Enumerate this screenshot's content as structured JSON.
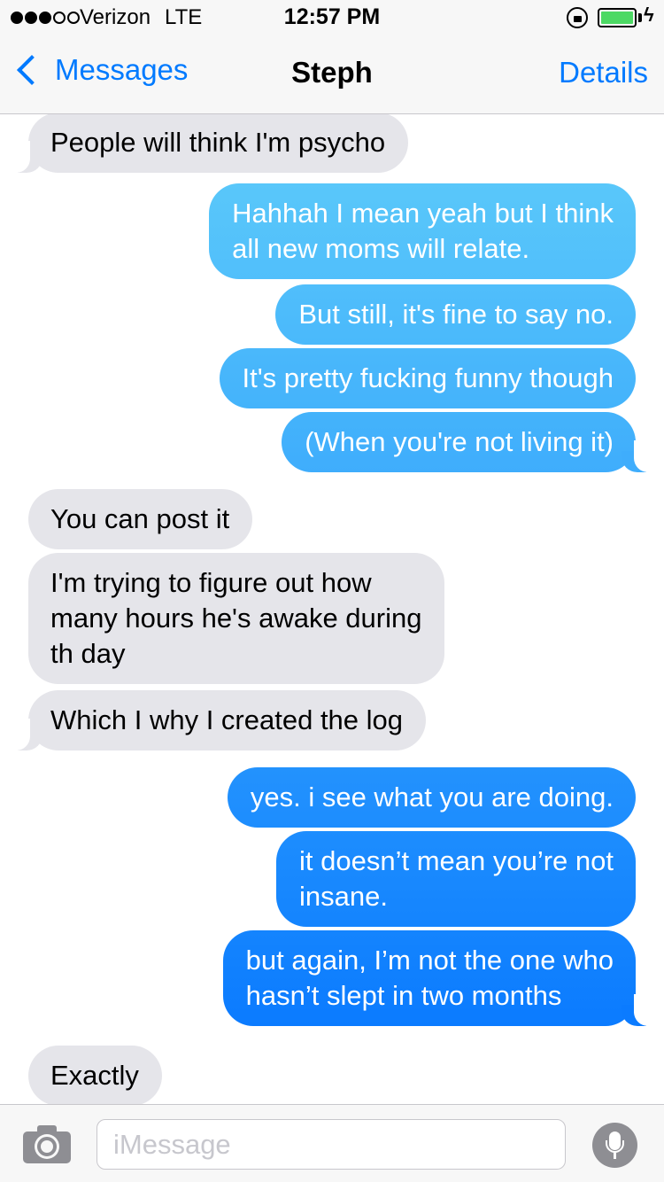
{
  "status_bar": {
    "carrier": "Verizon",
    "network": "LTE",
    "time": "12:57 PM",
    "signal_bars": 3,
    "signal_total": 5
  },
  "nav": {
    "back_label": "Messages",
    "title": "Steph",
    "details_label": "Details"
  },
  "colors": {
    "incoming_bubble": "#e5e5ea",
    "outgoing_gradient_top": "#5ac8fa",
    "outgoing_gradient_bottom": "#0a7aff",
    "link": "#007aff"
  },
  "messages": [
    {
      "dir": "in",
      "lines": [
        "People will think I'm psycho"
      ],
      "tail": true
    },
    {
      "dir": "out",
      "lines": [
        "Hahhah I mean yeah but I think",
        "all new moms will relate."
      ],
      "tail": false
    },
    {
      "dir": "out",
      "lines": [
        "But still, it's fine to say no."
      ],
      "tail": false
    },
    {
      "dir": "out",
      "lines": [
        "It's pretty fucking funny though"
      ],
      "tail": false
    },
    {
      "dir": "out",
      "lines": [
        "(When you're not living it)"
      ],
      "tail": true
    },
    {
      "dir": "in",
      "lines": [
        "You can post it"
      ],
      "tail": false
    },
    {
      "dir": "in",
      "lines": [
        "I'm trying to figure out how",
        "many hours he's awake during",
        "th day"
      ],
      "tail": false
    },
    {
      "dir": "in",
      "lines": [
        "Which I why I created the log"
      ],
      "tail": true
    },
    {
      "dir": "out",
      "lines": [
        "yes. i see what you are doing."
      ],
      "tail": false
    },
    {
      "dir": "out",
      "lines": [
        "it doesn’t mean you’re not",
        "insane."
      ],
      "tail": false
    },
    {
      "dir": "out",
      "lines": [
        "but again, I’m not the one who",
        "hasn’t slept in two months"
      ],
      "tail": true
    },
    {
      "dir": "in",
      "lines": [
        "Exactly"
      ],
      "tail": false
    }
  ],
  "input": {
    "placeholder": "iMessage"
  }
}
